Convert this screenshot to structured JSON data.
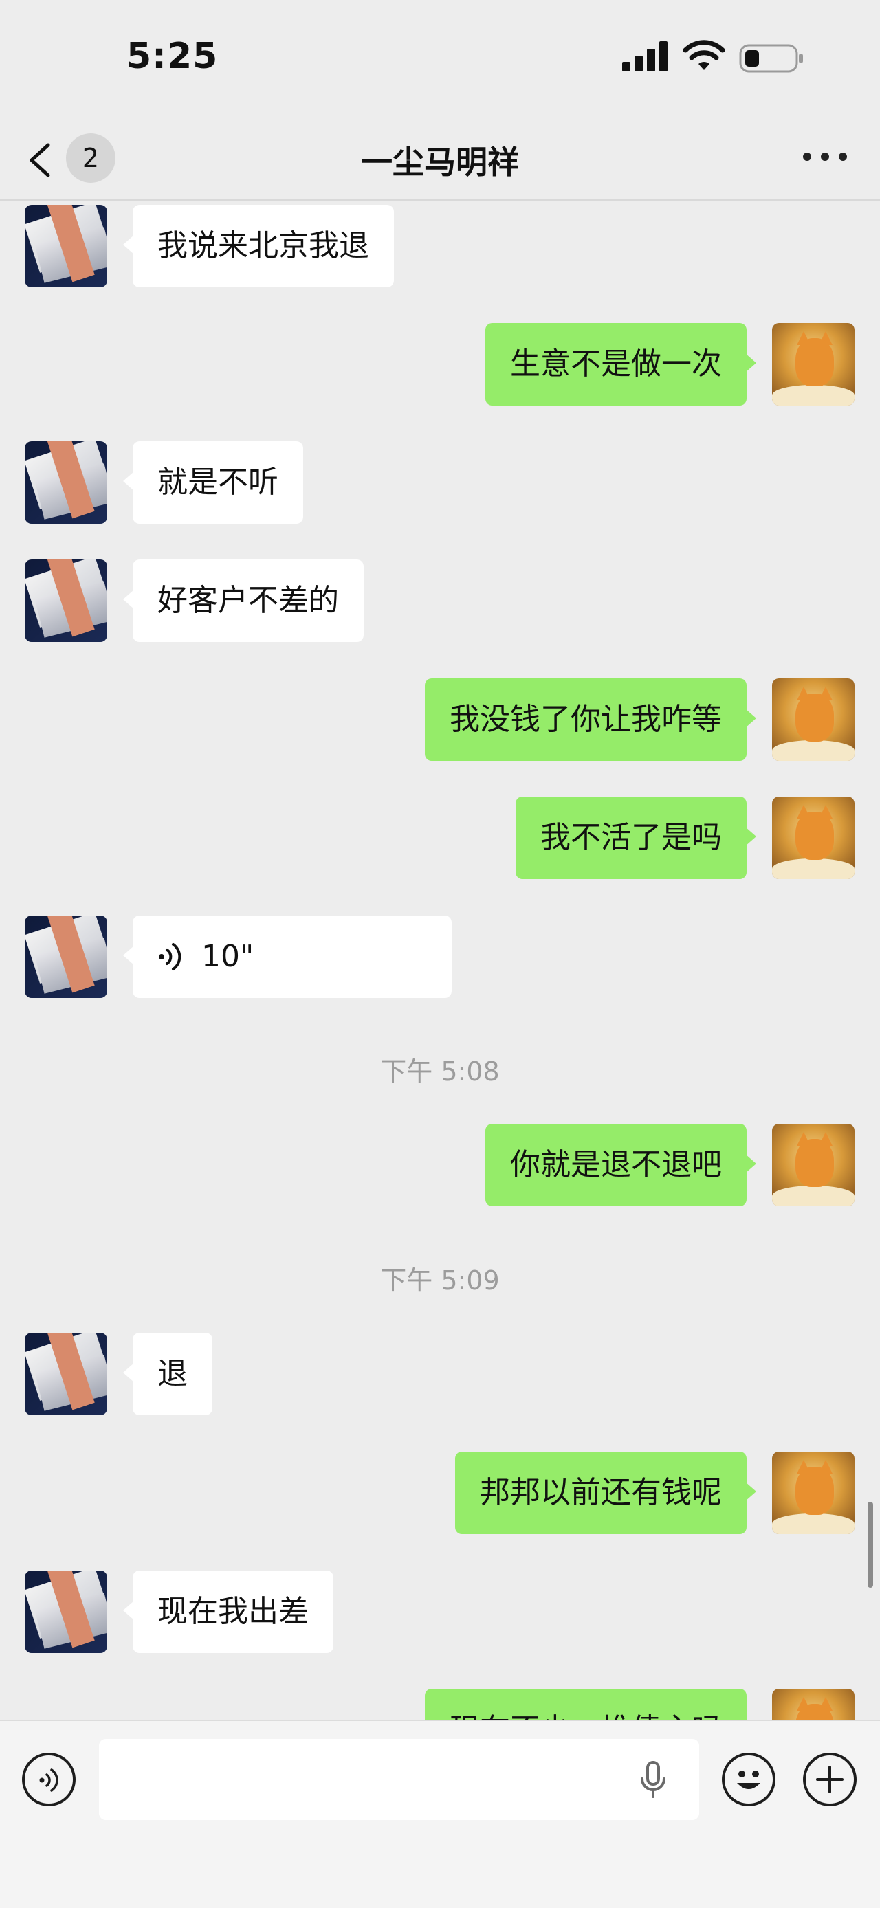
{
  "status_bar": {
    "time": "5:25"
  },
  "nav": {
    "back_badge": "2",
    "title": "一尘马明祥"
  },
  "messages": [
    {
      "side": "left",
      "type": "text",
      "text": "我说来北京我退"
    },
    {
      "side": "right",
      "type": "text",
      "text": "生意不是做一次"
    },
    {
      "side": "left",
      "type": "text",
      "text": "就是不听"
    },
    {
      "side": "left",
      "type": "text",
      "text": "好客户不差的"
    },
    {
      "side": "right",
      "type": "text",
      "text": "我没钱了你让我咋等"
    },
    {
      "side": "right",
      "type": "text",
      "text": "我不活了是吗"
    },
    {
      "side": "left",
      "type": "voice",
      "duration": "10\""
    },
    {
      "type": "timestamp",
      "text": "下午 5:08"
    },
    {
      "side": "right",
      "type": "text",
      "text": "你就是退不退吧"
    },
    {
      "type": "timestamp",
      "text": "下午 5:09"
    },
    {
      "side": "left",
      "type": "text",
      "text": "退"
    },
    {
      "side": "right",
      "type": "text",
      "text": "邦邦以前还有钱呢"
    },
    {
      "side": "left",
      "type": "text",
      "text": "现在我出差"
    },
    {
      "side": "right",
      "type": "text",
      "text": "现在不少一堆债主吗"
    }
  ],
  "input_bar": {
    "value": ""
  },
  "colors": {
    "sent_bubble": "#95ec69",
    "received_bubble": "#ffffff",
    "background": "#ededed"
  }
}
